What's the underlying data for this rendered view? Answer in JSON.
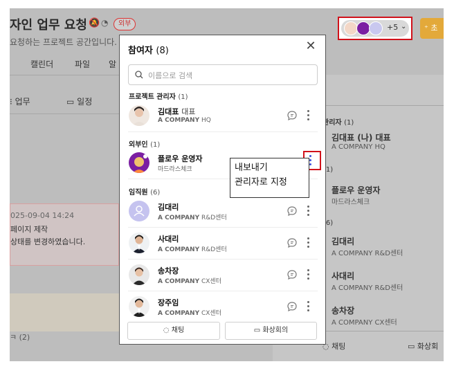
{
  "page": {
    "title_partial": "자인 업무 요청",
    "title_badge": "외부",
    "subtitle_partial": "요청하는 프로젝트 공간입니다.",
    "tabs": [
      "캘린더",
      "파일",
      "알"
    ],
    "toolbar": [
      "업무",
      "일정"
    ],
    "activity": {
      "time": "025-09-04 14:24",
      "line1": "페이지 제작",
      "line2": "상태를 변경하였습니다."
    },
    "section_partial": "(2)",
    "participants_more": "+5",
    "add_button_partial": "초"
  },
  "right_panel": {
    "sections": [
      {
        "label": "관리자",
        "count": "(1)"
      },
      {
        "label": "",
        "count": "(1)"
      },
      {
        "label": "",
        "count": "(6)"
      }
    ],
    "items": [
      {
        "name": "김대표 (나) 대표",
        "company": "A COMPANY",
        "dept": "HQ"
      },
      {
        "name": "플로우 운영자",
        "company": "마드라스체크",
        "dept": ""
      },
      {
        "name": "김대리",
        "company": "A COMPANY",
        "dept": "R&D센터"
      },
      {
        "name": "사대리",
        "company": "A COMPANY",
        "dept": "R&D센터"
      },
      {
        "name": "송차장",
        "company": "A COMPANY",
        "dept": "CX센터"
      }
    ],
    "footer": {
      "chat": "채팅",
      "video": "화상회"
    }
  },
  "modal": {
    "title": "참여자",
    "count": "(8)",
    "search_placeholder": "이름으로 검색",
    "sections": {
      "manager": {
        "label": "프로젝트 관리자",
        "count": "(1)"
      },
      "external": {
        "label": "외부인",
        "count": "(1)"
      },
      "employee": {
        "label": "임직원",
        "count": "(6)"
      }
    },
    "members": {
      "kim_ceo": {
        "name": "김대표",
        "title": "대표",
        "company": "A COMPANY",
        "dept": "HQ"
      },
      "flow_admin": {
        "name": "플로우 운영자",
        "title": "",
        "company": "마드라스체크",
        "dept": ""
      },
      "kim_deputy": {
        "name": "김대리",
        "title": "",
        "company": "A COMPANY",
        "dept": "R&D센터"
      },
      "sa_deputy": {
        "name": "사대리",
        "title": "",
        "company": "A COMPANY",
        "dept": "R&D센터"
      },
      "song_manager": {
        "name": "송차장",
        "title": "",
        "company": "A COMPANY",
        "dept": "CX센터"
      },
      "jang_chief": {
        "name": "장주임",
        "title": "",
        "company": "A COMPANY",
        "dept": "CX센터"
      }
    },
    "footer": {
      "chat": "채팅",
      "video": "화상회의"
    }
  },
  "tooltip": {
    "line1": "내보내기",
    "line2": "관리자로 지정"
  },
  "colors": {
    "highlight": "#d1111a",
    "external_avatar": "#7b1fa2",
    "accent": "#e3a93a",
    "more_dot_active": "#3b4fd8"
  }
}
